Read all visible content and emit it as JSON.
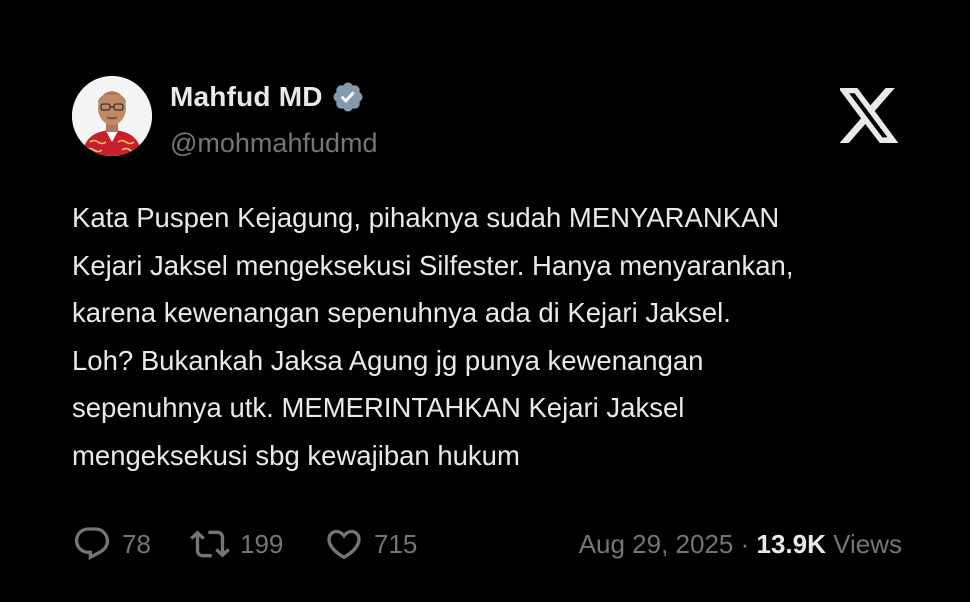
{
  "author": {
    "name": "Mahfud MD",
    "handle": "@mohmahfudmd",
    "verified": true,
    "avatar_icon": "profile-photo"
  },
  "brand": {
    "logo_icon": "x-logo"
  },
  "tweet": {
    "lines": [
      "Kata Puspen Kejagung, pihaknya sudah MENYARANKAN",
      "Kejari Jaksel mengeksekusi Silfester. Hanya menyarankan,",
      "karena kewenangan sepenuhnya ada di Kejari Jaksel.",
      "Loh? Bukankah Jaksa Agung jg punya kewenangan",
      "sepenuhnya utk. MEMERINTAHKAN Kejari Jaksel",
      "mengeksekusi sbg kewajiban hukum"
    ]
  },
  "stats": {
    "replies": "78",
    "retweets": "199",
    "likes": "715"
  },
  "meta": {
    "date": "Aug 29, 2025",
    "separator": " · ",
    "views_count": "13.9K",
    "views_label": " Views"
  },
  "colors": {
    "background": "#000000",
    "primary_text": "#e7e9ea",
    "secondary_text": "#71767b",
    "verified_badge": "#829aab"
  }
}
